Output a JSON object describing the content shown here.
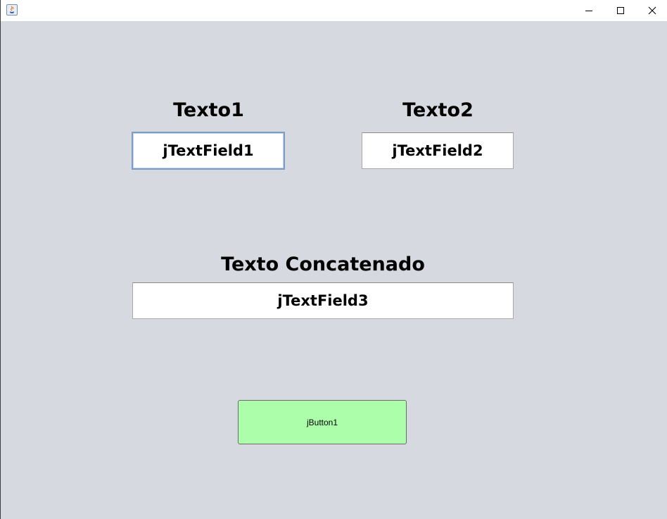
{
  "window": {
    "title": "",
    "controls": {
      "minimize_icon": "minimize-icon",
      "maximize_icon": "maximize-icon",
      "close_icon": "close-icon"
    },
    "background": "#d6d9df"
  },
  "form": {
    "label1": "Texto1",
    "label2": "Texto2",
    "label3": "Texto Concatenado",
    "field1": {
      "value": "jTextField1"
    },
    "field2": {
      "value": "jTextField2"
    },
    "field3": {
      "value": "jTextField3"
    },
    "button": {
      "label": "jButton1",
      "color": "#adfeab"
    }
  }
}
